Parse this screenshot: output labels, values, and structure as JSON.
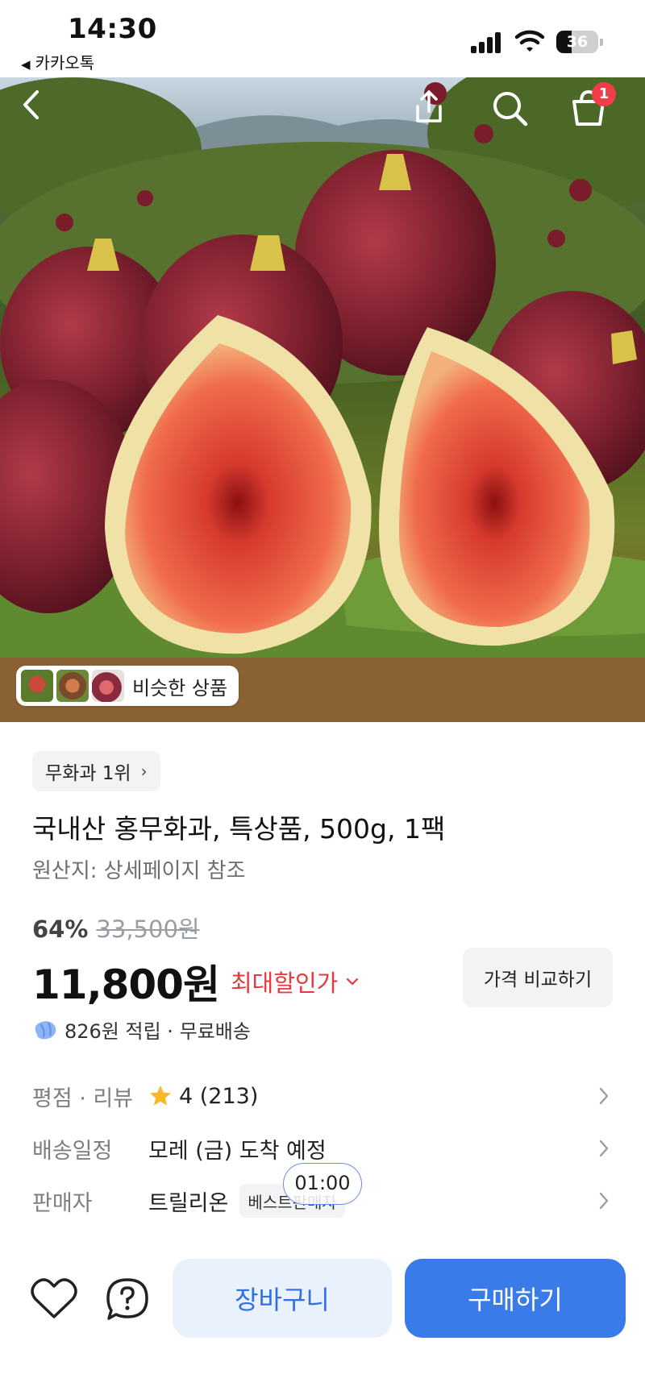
{
  "status_bar": {
    "time": "14:30",
    "back_app": "카카오톡",
    "battery": "36",
    "battery_level": 0.36
  },
  "hero": {
    "cart_badge": "1",
    "similar_label": "비슷한 상품"
  },
  "product": {
    "rank_chip": "무화과 1위",
    "title": "국내산 홍무화과, 특상품, 500g, 1팩",
    "origin": "원산지: 상세페이지 참조",
    "discount_percent": "64%",
    "original_price": "33,500원",
    "price": "11,800원",
    "max_discount_label": "최대할인가",
    "compare_button": "가격 비교하기",
    "points_text": "826원 적립 · 무료배송"
  },
  "info": {
    "rating_label": "평점 · 리뷰",
    "rating_value": "4 (213)",
    "delivery_label": "배송일정",
    "delivery_value": "모레 (금) 도착 예정",
    "seller_label": "판매자",
    "seller_value": "트릴리온",
    "seller_badge": "베스트판매자",
    "timer": "01:00"
  },
  "bottom_bar": {
    "cart_button": "장바구니",
    "buy_button": "구매하기"
  },
  "colors": {
    "accent": "#3a7bea",
    "sale_red": "#e8383d",
    "badge_red": "#f23d4a"
  },
  "icons": [
    "back-icon",
    "share-icon",
    "search-icon",
    "cart-icon",
    "chevron-right-icon",
    "chevron-down-icon",
    "star-icon",
    "points-gem-icon",
    "heart-icon",
    "help-icon"
  ]
}
